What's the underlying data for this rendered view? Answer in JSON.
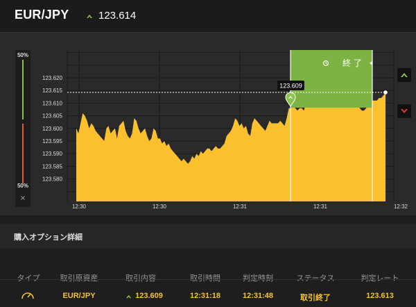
{
  "header": {
    "pair": "EUR/JPY",
    "price": "123.614",
    "trend": "up"
  },
  "gauge": {
    "top_label": "50%",
    "bottom_label": "50%",
    "close": "×"
  },
  "chart": {
    "y_ticks": [
      "123.620",
      "123.615",
      "123.610",
      "123.605",
      "123.600",
      "123.595",
      "123.590",
      "123.585",
      "123.580"
    ],
    "x_ticks": [
      "12:30",
      "12:30",
      "12:31",
      "12:31",
      "12:32"
    ],
    "entry_label": "123.609",
    "panel_label": "終 了",
    "colors": {
      "area": "#fbc02d",
      "panel": "#7cb342",
      "up": "#8bc34a",
      "down": "#e53935"
    },
    "series": [
      123.6,
      123.598,
      123.602,
      123.606,
      123.605,
      123.603,
      123.6,
      123.602,
      123.601,
      123.599,
      123.598,
      123.597,
      123.596,
      123.595,
      123.6,
      123.601,
      123.598,
      123.599,
      123.6,
      123.596,
      123.601,
      123.602,
      123.603,
      123.599,
      123.597,
      123.596,
      123.598,
      123.604,
      123.603,
      123.6,
      123.598,
      123.599,
      123.6,
      123.597,
      123.595,
      123.596,
      123.6,
      123.599,
      123.596,
      123.596,
      123.594,
      123.595,
      123.593,
      123.594,
      123.592,
      123.591,
      123.59,
      123.589,
      123.588,
      123.587,
      123.588,
      123.587,
      123.586,
      123.587,
      123.589,
      123.588,
      123.59,
      123.589,
      123.591,
      123.59,
      123.591,
      123.592,
      123.592,
      123.591,
      123.592,
      123.593,
      123.592,
      123.592,
      123.593,
      123.594,
      123.597,
      123.598,
      123.599,
      123.601,
      123.604,
      123.603,
      123.601,
      123.602,
      123.6,
      123.601,
      123.598,
      123.597,
      123.602,
      123.604,
      123.603,
      123.602,
      123.601,
      123.6,
      123.599,
      123.601,
      123.603,
      123.602,
      123.602,
      123.602,
      123.602,
      123.603,
      123.602,
      123.601,
      123.604,
      123.608,
      123.608,
      123.609,
      123.608,
      123.607,
      123.608,
      123.608,
      123.607,
      123.61,
      123.61,
      123.612,
      123.613,
      123.614,
      123.614,
      123.614,
      123.615,
      123.614,
      123.615,
      123.612,
      123.612,
      123.614,
      123.615,
      123.614,
      123.612,
      123.612,
      123.614,
      123.614,
      123.614,
      123.614,
      123.611,
      123.612,
      123.611,
      123.61,
      123.608,
      123.607,
      123.607,
      123.608,
      123.609,
      123.61,
      123.611,
      123.611,
      123.611,
      123.612,
      123.612,
      123.613,
      123.614
    ]
  },
  "details": {
    "title": "購入オプション詳細"
  },
  "table": {
    "headers": [
      "タイプ",
      "取引原資産",
      "取引内容",
      "取引時間",
      "判定時刻",
      "ステータス",
      "判定レート"
    ],
    "row": {
      "asset": "EUR/JPY",
      "content": "123.609",
      "trade_time": "12:31:18",
      "judge_time": "12:31:48",
      "status": "取引終了",
      "rate": "123.613"
    }
  }
}
